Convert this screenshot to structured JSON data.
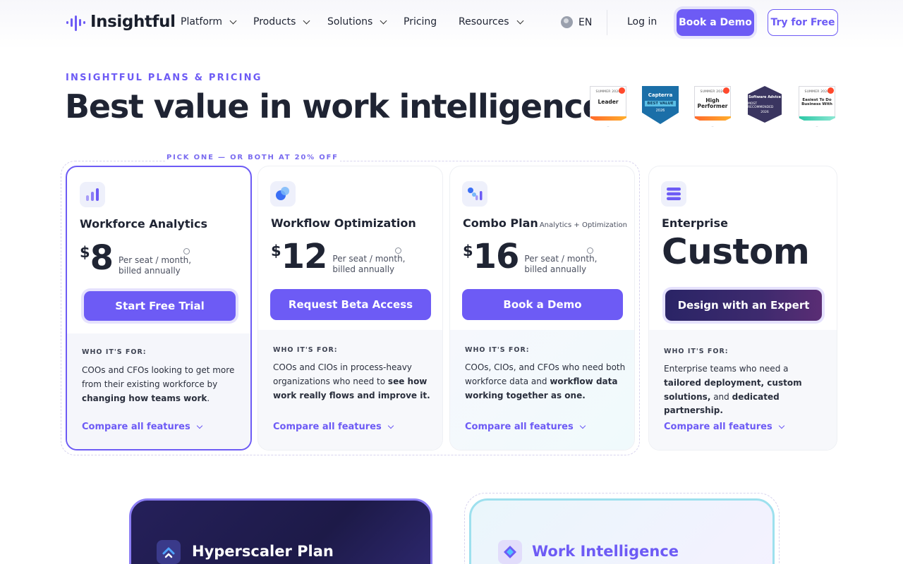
{
  "nav": {
    "logo": "Insightful",
    "items": [
      {
        "label": "Platform"
      },
      {
        "label": "Products"
      },
      {
        "label": "Solutions"
      },
      {
        "label": "Pricing"
      },
      {
        "label": "Resources"
      }
    ],
    "language": "EN",
    "login": "Log in",
    "book_demo": "Book a Demo",
    "try_free": "Try for Free"
  },
  "hero": {
    "eyebrow": "INSIGHTFUL PLANS & PRICING",
    "title": "Best value in work intelligence"
  },
  "badges": [
    {
      "top": "SUMMER 2026",
      "text": "Leader"
    },
    {
      "top": "Capterra",
      "text": "BEST VALUE",
      "year": "2026"
    },
    {
      "top": "SUMMER 2026",
      "text": "High Performer"
    },
    {
      "top": "Software Advice",
      "text": "MOST RECOMMENDED",
      "year": "2026"
    },
    {
      "top": "SUMMER 2026",
      "text": "Easiest To Do Business With"
    }
  ],
  "pick_label": "PICK ONE — OR BOTH AT 20% OFF",
  "plans": [
    {
      "name": "Workforce Analytics",
      "currency": "$",
      "price": "8",
      "per_line1": "Per seat / month,",
      "per_line2": "billed annually",
      "cta": "Start Free Trial",
      "who_label": "WHO IT'S FOR:",
      "desc_plain": "COOs and CFOs looking to get more from their existing workforce by ",
      "desc_bold": "changing how teams work",
      "desc_end": ".",
      "compare": "Compare all features"
    },
    {
      "name": "Workflow Optimization",
      "currency": "$",
      "price": "12",
      "per_line1": "Per seat / month,",
      "per_line2": "billed annually",
      "cta": "Request Beta Access",
      "who_label": "WHO IT'S FOR:",
      "desc_plain": "COOs and CIOs in process-heavy organizations who need to ",
      "desc_bold": "see how work really flows and improve it.",
      "desc_end": "",
      "compare": "Compare all features"
    },
    {
      "name": "Combo Plan",
      "subtitle": "Analytics + Optimization",
      "currency": "$",
      "price": "16",
      "per_line1": "Per seat / month,",
      "per_line2": "billed annually",
      "cta": "Book a Demo",
      "who_label": "WHO IT'S FOR:",
      "desc_plain": "COOs, CIOs, and CFOs who need both workforce data and ",
      "desc_bold": "workflow data working together as one.",
      "desc_end": "",
      "compare": "Compare all features"
    },
    {
      "name": "Enterprise",
      "price_text": "Custom",
      "cta": "Design with an Expert",
      "who_label": "WHO IT'S FOR:",
      "desc_plain": "Enterprise teams who need a ",
      "desc_bold": "tailored deployment, custom solutions,",
      "desc_mid": " and ",
      "desc_bold2": "dedicated partnership.",
      "compare": "Compare all features"
    }
  ],
  "bottom": {
    "hyper_title": "Hyperscaler Plan",
    "wi_title": "Work Intelligence"
  },
  "colors": {
    "accent": "#6d5bf5",
    "text": "#1f2433",
    "enterprise_cta_start": "#2a2466",
    "enterprise_cta_end": "#5a2d74"
  }
}
